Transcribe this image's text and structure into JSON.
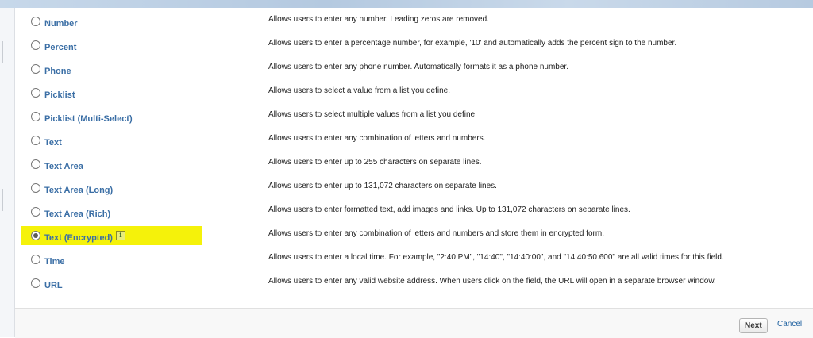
{
  "options": [
    {
      "label": "Number",
      "description": "Allows users to enter any number. Leading zeros are removed.",
      "selected": false
    },
    {
      "label": "Percent",
      "description": "Allows users to enter a percentage number, for example, '10' and automatically adds the percent sign to the number.",
      "selected": false
    },
    {
      "label": "Phone",
      "description": "Allows users to enter any phone number. Automatically formats it as a phone number.",
      "selected": false
    },
    {
      "label": "Picklist",
      "description": "Allows users to select a value from a list you define.",
      "selected": false
    },
    {
      "label": "Picklist (Multi-Select)",
      "description": "Allows users to select multiple values from a list you define.",
      "selected": false
    },
    {
      "label": "Text",
      "description": "Allows users to enter any combination of letters and numbers.",
      "selected": false
    },
    {
      "label": "Text Area",
      "description": "Allows users to enter up to 255 characters on separate lines.",
      "selected": false
    },
    {
      "label": "Text Area (Long)",
      "description": "Allows users to enter up to 131,072 characters on separate lines.",
      "selected": false
    },
    {
      "label": "Text Area (Rich)",
      "description": "Allows users to enter formatted text, add images and links. Up to 131,072 characters on separate lines.",
      "selected": false
    },
    {
      "label": "Text (Encrypted)",
      "description": "Allows users to enter any combination of letters and numbers and store them in encrypted form.",
      "selected": true,
      "info_icon": "i"
    },
    {
      "label": "Time",
      "description": "Allows users to enter a local time. For example, \"2:40 PM\", \"14:40\", \"14:40:00\", and \"14:40:50.600\" are all valid times for this field.",
      "selected": false
    },
    {
      "label": "URL",
      "description": "Allows users to enter any valid website address. When users click on the field, the URL will open in a separate browser window.",
      "selected": false
    }
  ],
  "footer": {
    "next_label": "Next",
    "cancel_label": "Cancel"
  },
  "colors": {
    "highlight": "#f5f20a",
    "label": "#3a6ea5",
    "link": "#1a5e9e"
  }
}
